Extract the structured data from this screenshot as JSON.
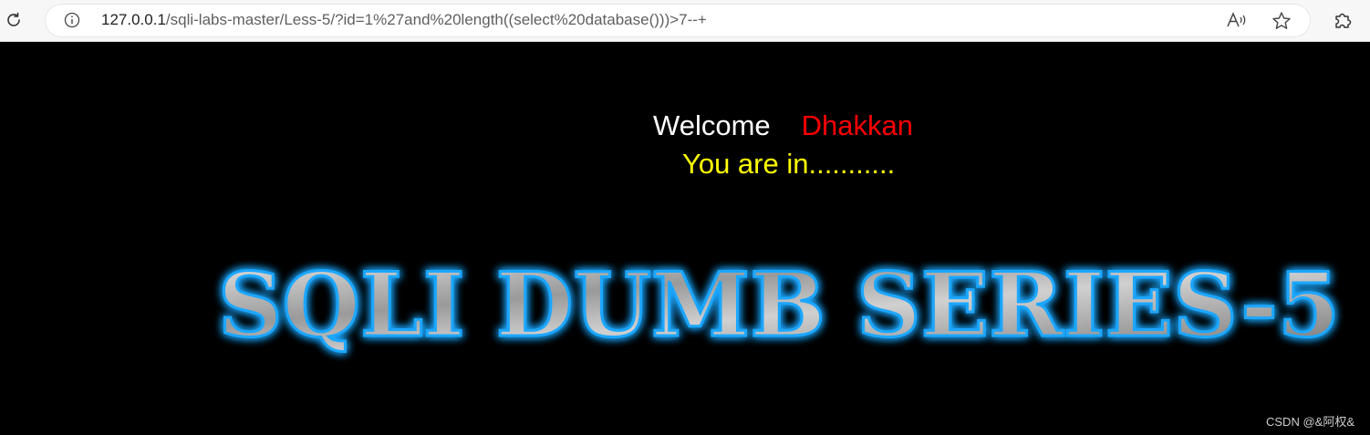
{
  "browser": {
    "url_host": "127.0.0.1",
    "url_path": "/sqli-labs-master/Less-5/?id=1%27and%20length((select%20database()))>7--+",
    "icons": [
      "reload-icon",
      "site-info-icon",
      "read-aloud-icon",
      "favorite-star-icon",
      "extensions-icon"
    ]
  },
  "page": {
    "welcome": "Welcome",
    "name": "Dhakkan",
    "status": "You are in...........",
    "banner": "SQLI DUMB SERIES-5",
    "watermark": "CSDN @&阿权&"
  },
  "colors": {
    "background": "#000000",
    "welcome": "#ffffff",
    "name": "#ff0000",
    "status": "#ffff00",
    "banner_glow": "#1ea7ff"
  }
}
